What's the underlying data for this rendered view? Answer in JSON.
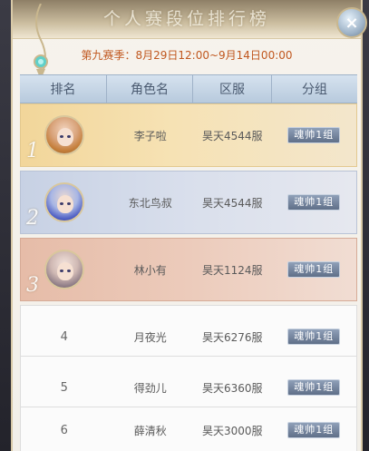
{
  "panel": {
    "title": "个人赛段位排行榜",
    "close_icon": "×",
    "season_text": "第九赛季：8月29日12:00~9月14日00:00"
  },
  "table": {
    "headers": [
      "排名",
      "角色名",
      "区服",
      "分组"
    ],
    "rows": [
      {
        "rank": "1",
        "name": "李子啦",
        "server": "昊天4544服",
        "group": "魂帅1组"
      },
      {
        "rank": "2",
        "name": "东北鸟叔",
        "server": "昊天4544服",
        "group": "魂帅1组"
      },
      {
        "rank": "3",
        "name": "林小有",
        "server": "昊天1124服",
        "group": "魂帅1组"
      },
      {
        "rank": "4",
        "name": "月夜光",
        "server": "昊天6276服",
        "group": "魂帅1组"
      },
      {
        "rank": "5",
        "name": "得劲儿",
        "server": "昊天6360服",
        "group": "魂帅1组"
      },
      {
        "rank": "6",
        "name": "薛清秋",
        "server": "昊天3000服",
        "group": "魂帅1组"
      }
    ]
  }
}
